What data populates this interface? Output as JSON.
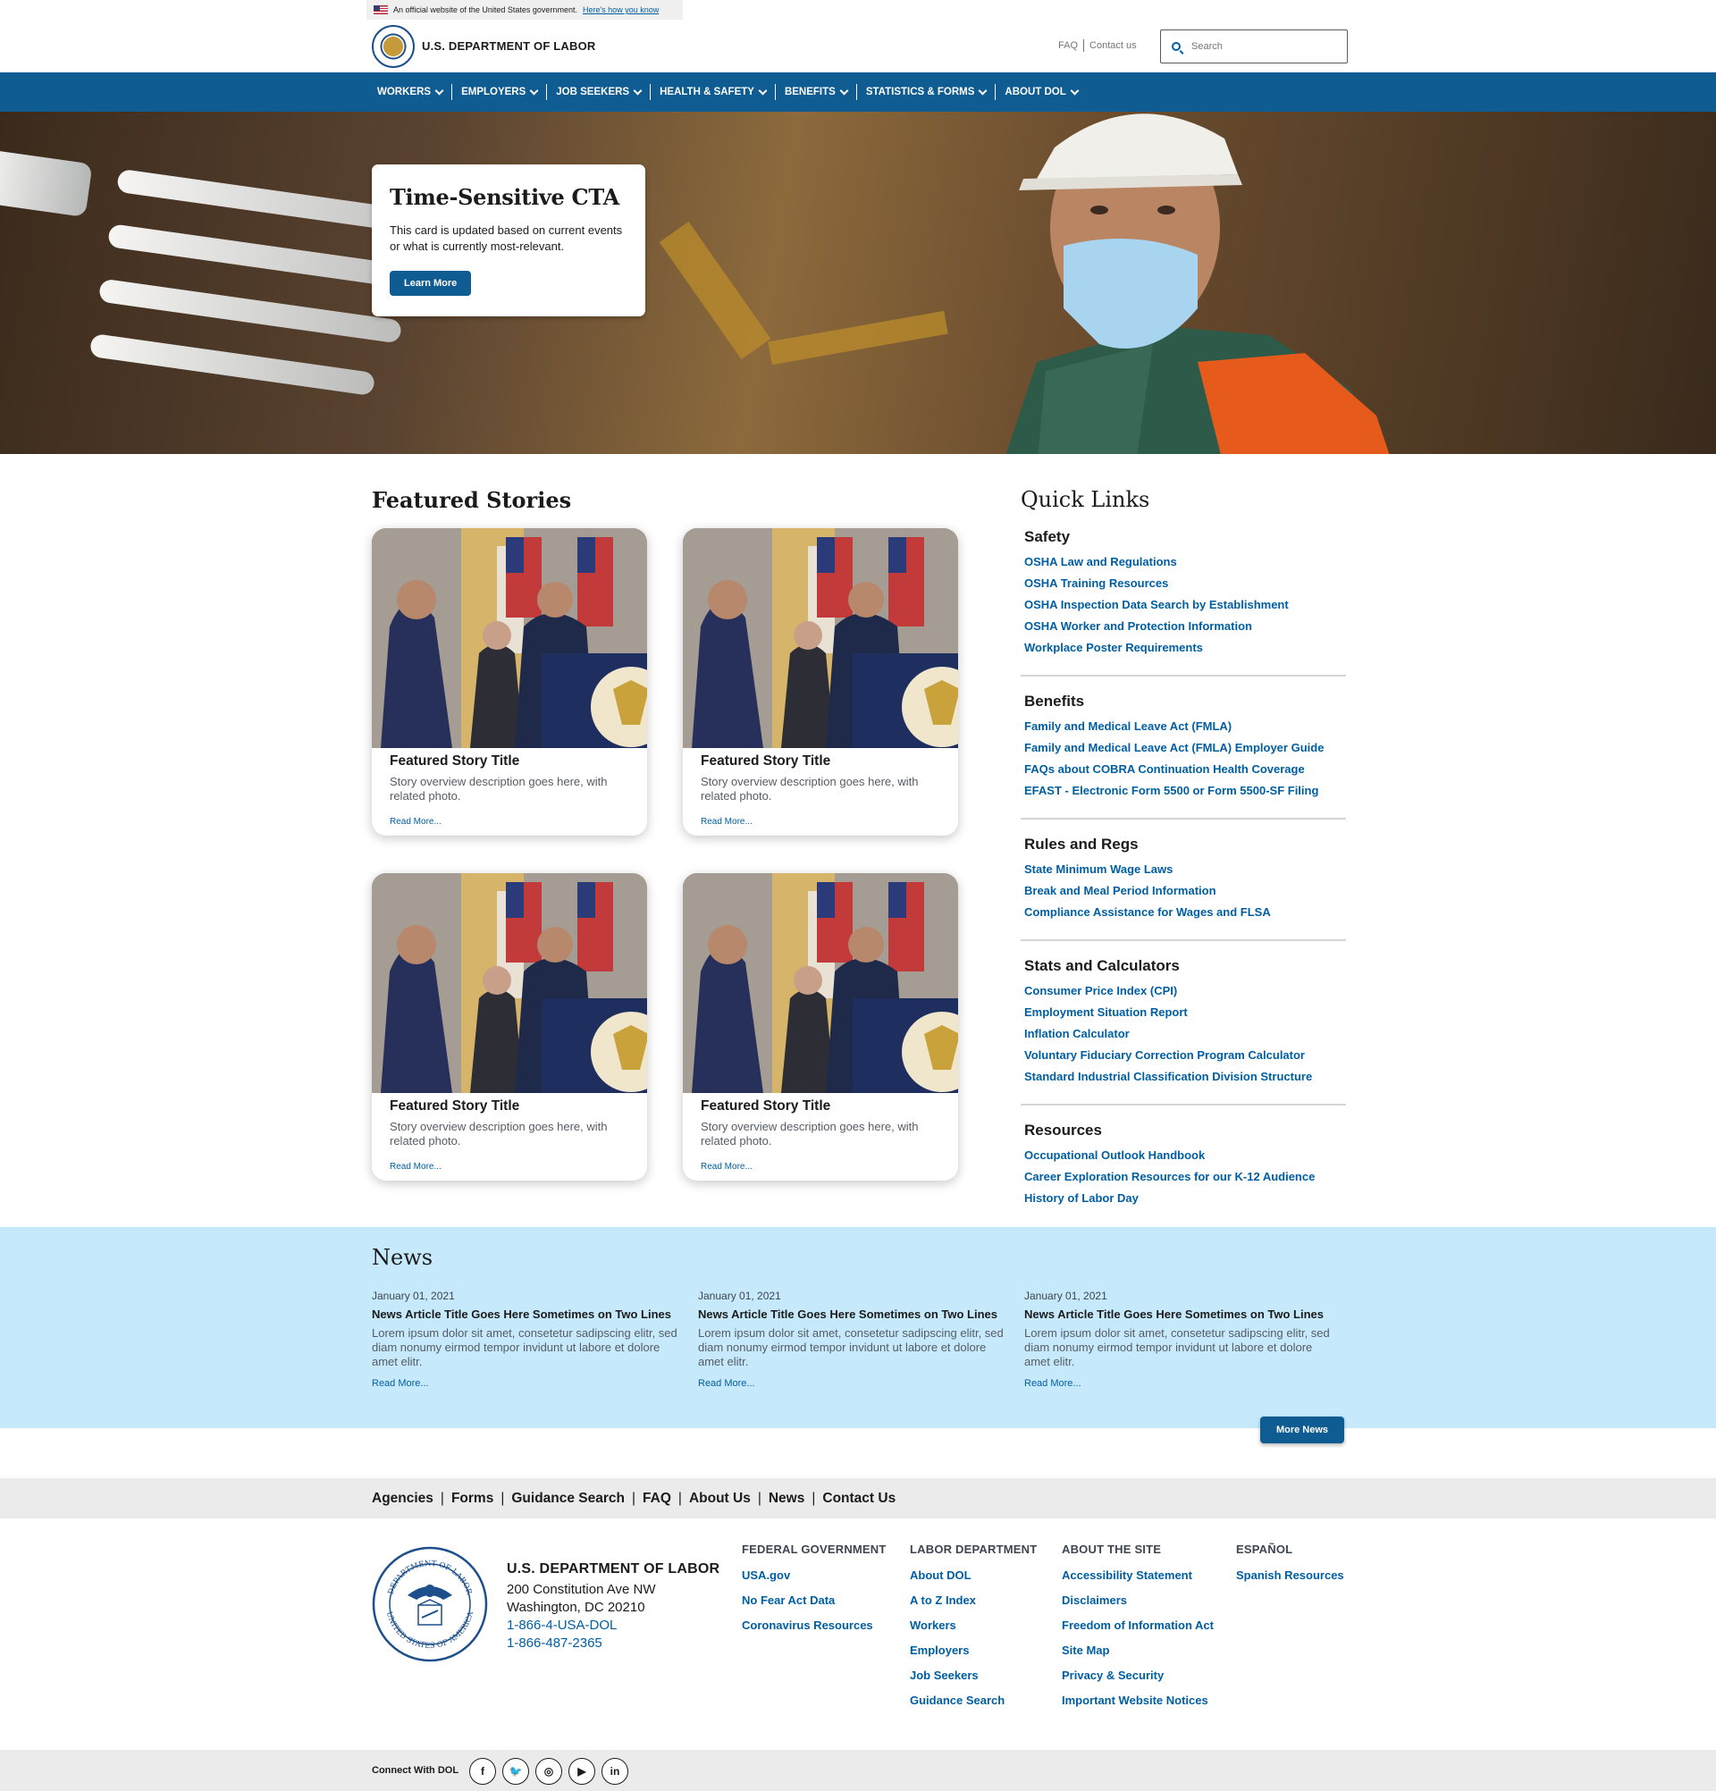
{
  "gov_banner": {
    "text": "An official website of the United States government.",
    "how": "Here's how you know"
  },
  "header": {
    "brand": "U.S. DEPARTMENT OF LABOR",
    "links": [
      "FAQ",
      "Contact us"
    ],
    "search_placeholder": "Search"
  },
  "nav": [
    "WORKERS",
    "EMPLOYERS",
    "JOB SEEKERS",
    "HEALTH & SAFETY",
    "BENEFITS",
    "STATISTICS & FORMS",
    "ABOUT DOL"
  ],
  "hero": {
    "title": "Time-Sensitive CTA",
    "text": "This card is updated based on current events or what is currently most-relevant.",
    "button": "Learn More"
  },
  "featured": {
    "title": "Featured Stories",
    "cards": [
      {
        "title": "Featured Story Title",
        "desc": "Story overview description goes here, with related photo.",
        "more": "Read More..."
      },
      {
        "title": "Featured Story Title",
        "desc": "Story overview description goes here, with related photo.",
        "more": "Read More..."
      },
      {
        "title": "Featured Story Title",
        "desc": "Story overview description goes here, with related photo.",
        "more": "Read More..."
      },
      {
        "title": "Featured Story Title",
        "desc": "Story overview description goes here, with related photo.",
        "more": "Read More..."
      }
    ]
  },
  "quick_links": {
    "title": "Quick Links",
    "sections": [
      {
        "title": "Safety",
        "links": [
          "OSHA Law and Regulations",
          "OSHA Training Resources",
          "OSHA Inspection Data Search by Establishment",
          "OSHA Worker and Protection Information",
          "Workplace Poster Requirements"
        ]
      },
      {
        "title": "Benefits",
        "links": [
          "Family and Medical Leave Act (FMLA)",
          "Family and Medical Leave Act (FMLA) Employer Guide",
          "FAQs about COBRA Continuation Health Coverage",
          "EFAST - Electronic Form 5500 or Form 5500-SF Filing"
        ]
      },
      {
        "title": "Rules and Regs",
        "links": [
          "State Minimum Wage Laws",
          "Break and Meal Period Information",
          "Compliance Assistance for Wages and FLSA"
        ]
      },
      {
        "title": "Stats and Calculators",
        "links": [
          "Consumer Price Index (CPI)",
          "Employment Situation Report",
          "Inflation Calculator",
          "Voluntary Fiduciary Correction Program Calculator",
          "Standard Industrial Classification Division Structure"
        ]
      },
      {
        "title": "Resources",
        "links": [
          "Occupational Outlook Handbook",
          "Career Exploration Resources for our K-12 Audience",
          "History of Labor Day"
        ]
      }
    ]
  },
  "news": {
    "title": "News",
    "items": [
      {
        "date": "January 01, 2021",
        "title": "News Article Title Goes Here Sometimes on Two Lines",
        "text": "Lorem ipsum dolor sit amet, consetetur sadipscing elitr, sed diam nonumy eirmod tempor invidunt ut labore et dolore amet elitr.",
        "more": "Read More..."
      },
      {
        "date": "January 01, 2021",
        "title": "News Article Title Goes Here Sometimes on Two Lines",
        "text": "Lorem ipsum dolor sit amet, consetetur sadipscing elitr, sed diam nonumy eirmod tempor invidunt ut labore et dolore amet elitr.",
        "more": "Read More..."
      },
      {
        "date": "January 01, 2021",
        "title": "News Article Title Goes Here Sometimes on Two Lines",
        "text": "Lorem ipsum dolor sit amet, consetetur sadipscing elitr, sed diam nonumy eirmod tempor invidunt ut labore et dolore amet elitr.",
        "more": "Read More..."
      }
    ],
    "more_button": "More News"
  },
  "footer_bar": [
    "Agencies",
    "Forms",
    "Guidance Search",
    "FAQ",
    "About Us",
    "News",
    "Contact Us"
  ],
  "footer": {
    "org": "U.S. DEPARTMENT OF LABOR",
    "address1": "200 Constitution Ave NW",
    "address2": "Washington, DC 20210",
    "phone1": "1-866-4-USA-DOL",
    "phone2": "1-866-487-2365",
    "seal_text_top": "DEPARTMENT OF LABOR",
    "seal_text_bottom": "UNITED STATES OF AMERICA",
    "columns": [
      {
        "title": "FEDERAL GOVERNMENT",
        "links": [
          "USA.gov",
          "No Fear Act Data",
          "Coronavirus Resources"
        ]
      },
      {
        "title": "LABOR DEPARTMENT",
        "links": [
          "About DOL",
          "A to Z Index",
          "Workers",
          "Employers",
          "Job Seekers",
          "Guidance Search"
        ]
      },
      {
        "title": "ABOUT THE SITE",
        "links": [
          "Accessibility Statement",
          "Disclaimers",
          "Freedom of Information Act",
          "Site Map",
          "Privacy & Security",
          "Important Website Notices"
        ]
      },
      {
        "title": "ESPAÑOL",
        "links": [
          "Spanish Resources"
        ]
      }
    ]
  },
  "social": {
    "label": "Connect With DOL",
    "icons": [
      "facebook-icon",
      "twitter-icon",
      "instagram-icon",
      "youtube-icon",
      "linkedin-icon"
    ],
    "glyphs": [
      "f",
      "🐦",
      "◎",
      "▶",
      "in"
    ]
  },
  "colors": {
    "primary": "#0f5c92",
    "link": "#005ea2",
    "news_bg": "#c6e9fb",
    "footer_bg": "#ebebeb"
  }
}
